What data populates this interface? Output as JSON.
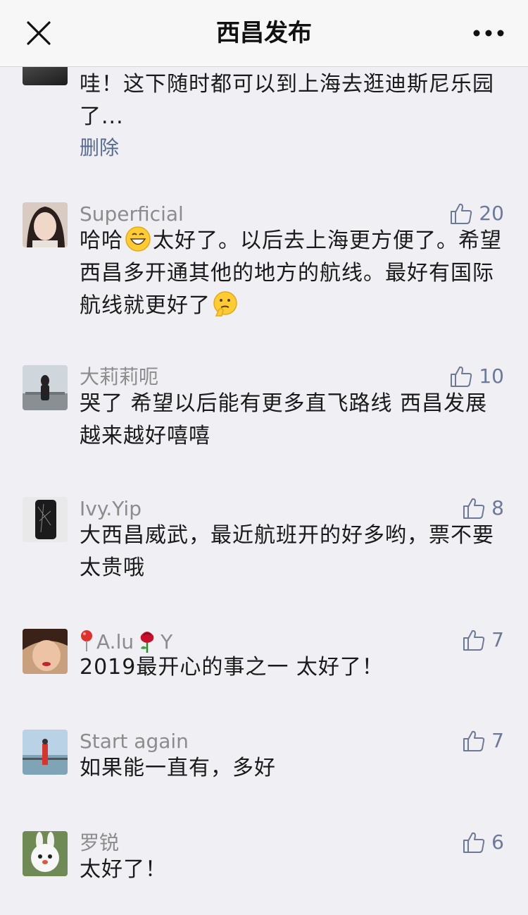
{
  "header": {
    "title": "西昌发布",
    "close_icon": "close-icon",
    "more_icon": "more-icon"
  },
  "comments": [
    {
      "nickname": "",
      "text": "哇！这下随时都可以到上海去逛迪斯尼乐园了...",
      "action_label": "删除"
    },
    {
      "nickname": "Superficial",
      "likes": "20",
      "text_part1": "哈哈",
      "text_part2": "太好了。以后去上海更方便了。希望西昌多开通其他的地方的航线。最好有国际航线就更好了",
      "emoji_1": "grinning-face-icon",
      "emoji_2": "thinking-face-icon"
    },
    {
      "nickname": "大莉莉呃",
      "likes": "10",
      "text": "哭了 希望以后能有更多直飞路线 西昌发展越来越好嘻嘻"
    },
    {
      "nickname": "Ivy.Yip",
      "likes": "8",
      "text": "大西昌威武，最近航班开的好多哟，票不要太贵哦"
    },
    {
      "nickname_part1": "A.lu",
      "nickname_part2": "Y",
      "likes": "7",
      "text": "2019最开心的事之一 太好了！",
      "nickname_icons": [
        "pin-icon",
        "rose-icon"
      ]
    },
    {
      "nickname": "Start again",
      "likes": "7",
      "text": "如果能一直有，多好"
    },
    {
      "nickname": "罗锐",
      "likes": "6",
      "text": "太好了！"
    }
  ],
  "colors": {
    "background": "#efeff4",
    "link": "#576b95",
    "like": "#6b7a99",
    "nickname": "#8c8c8c"
  }
}
